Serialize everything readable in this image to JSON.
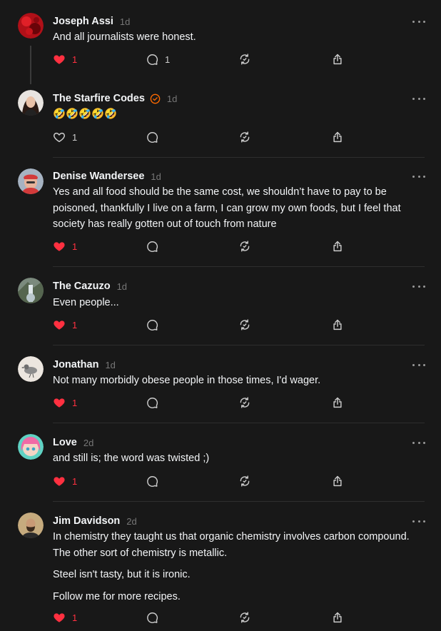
{
  "colors": {
    "background": "#181818",
    "text": "#f3f5f7",
    "muted": "#777777",
    "like": "#ff3040",
    "verified": "#ff6a00",
    "divider": "#2e2e2e"
  },
  "icons": {
    "like": "heart-icon",
    "reply": "comment-icon",
    "repost": "repost-icon",
    "share": "share-icon",
    "more": "more-icon",
    "verified": "verified-badge-icon"
  },
  "posts": [
    {
      "name": "Joseph Assi",
      "time": "1d",
      "verified": false,
      "paragraphs": [
        "And all journalists were honest."
      ],
      "liked": true,
      "likes": "1",
      "replies": "1",
      "thread_continues": true
    },
    {
      "name": "The Starfire Codes",
      "time": "1d",
      "verified": true,
      "paragraphs": [
        "🤣🤣🤣🤣🤣"
      ],
      "liked": false,
      "likes": "1",
      "replies": "",
      "thread_continues": false
    },
    {
      "name": "Denise Wandersee",
      "time": "1d",
      "verified": false,
      "paragraphs": [
        "Yes and all food should be the same cost, we shouldn’t have to pay to be poisoned, thankfully I live on a farm, I can grow my own foods, but I feel that society has really gotten out of touch from nature"
      ],
      "liked": true,
      "likes": "1",
      "replies": "",
      "thread_continues": false
    },
    {
      "name": "The Cazuzo",
      "time": "1d",
      "verified": false,
      "paragraphs": [
        "Even people..."
      ],
      "liked": true,
      "likes": "1",
      "replies": "",
      "thread_continues": false
    },
    {
      "name": "Jonathan",
      "time": "1d",
      "verified": false,
      "paragraphs": [
        "Not many morbidly obese people in those times, I'd wager."
      ],
      "liked": true,
      "likes": "1",
      "replies": "",
      "thread_continues": false
    },
    {
      "name": "Love",
      "time": "2d",
      "verified": false,
      "paragraphs": [
        "and still is; the word was twisted ;)"
      ],
      "liked": true,
      "likes": "1",
      "replies": "",
      "thread_continues": false
    },
    {
      "name": "Jim Davidson",
      "time": "2d",
      "verified": false,
      "paragraphs": [
        "In chemistry they taught us that organic chemistry involves carbon compound. The other sort of chemistry is metallic.",
        "Steel isn't tasty, but it is ironic.",
        "Follow me for more recipes."
      ],
      "liked": true,
      "likes": "1",
      "replies": "",
      "thread_continues": false
    }
  ]
}
